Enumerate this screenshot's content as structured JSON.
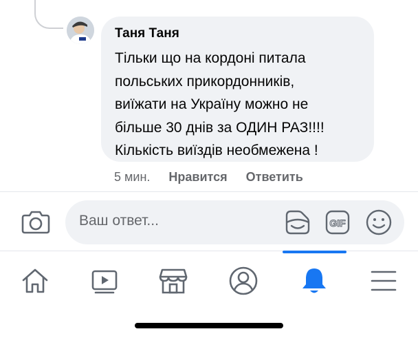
{
  "comment": {
    "author": "Таня Таня",
    "lines": [
      "Тільки що на кордоні питала",
      "польських прикордонників,",
      "виїжати на Україну можно не",
      "більше 30 днів за ОДИН РАЗ!!!!",
      "Кількість виїздів необмежена !"
    ],
    "time": "5 мин.",
    "like_label": "Нравится",
    "reply_label": "Ответить"
  },
  "composer": {
    "placeholder": "Ваш ответ...",
    "gif_label": "GIF",
    "icons": [
      "camera-icon",
      "sticker-icon",
      "gif-icon",
      "emoji-icon"
    ]
  },
  "bottom_nav": {
    "items": [
      "home-icon",
      "video-icon",
      "marketplace-icon",
      "profile-icon",
      "notifications-icon",
      "menu-icon"
    ],
    "active": "notifications-icon"
  },
  "colors": {
    "accent": "#1877f2",
    "bubble": "#f0f2f5",
    "secondary_text": "#65676b",
    "icon": "#606770"
  }
}
